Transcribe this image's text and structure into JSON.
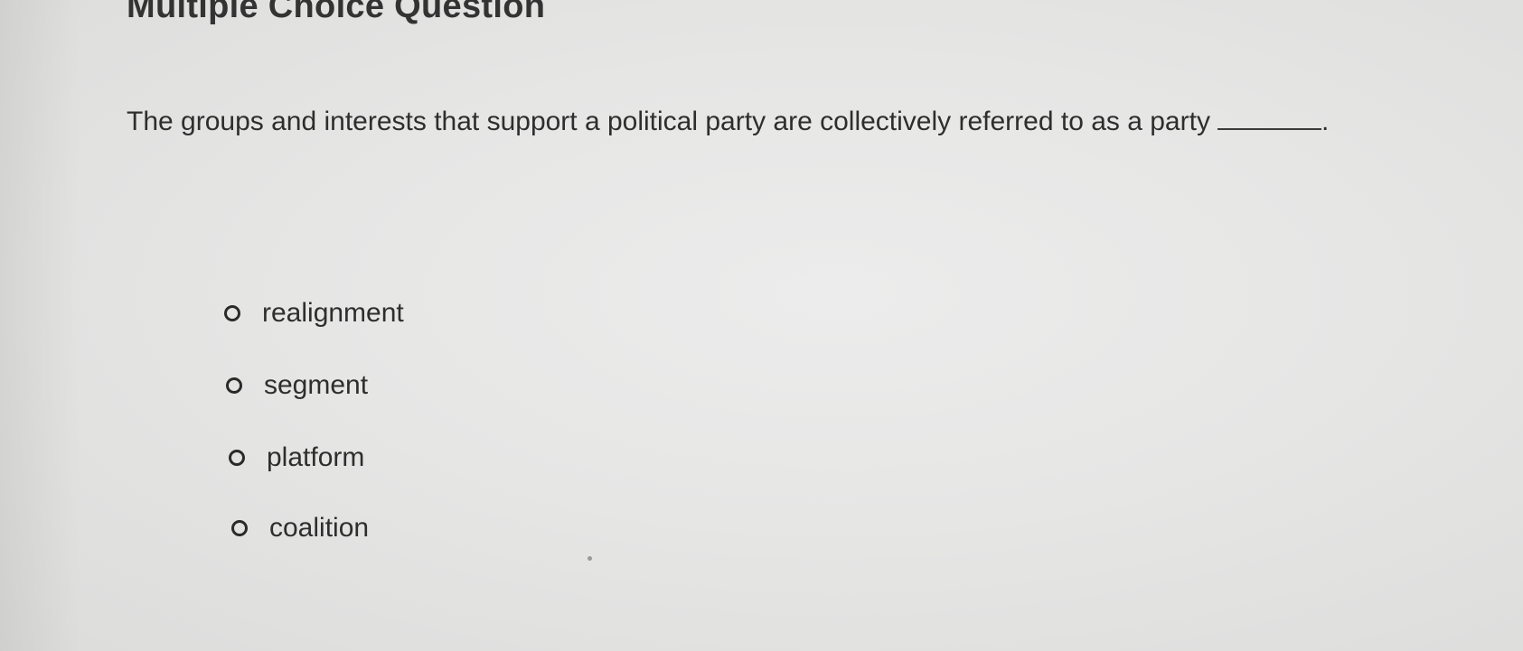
{
  "question_header": {
    "title": "Multiple Choice Question"
  },
  "question": {
    "text": "The groups and interests that support a political party are collectively referred to as a party",
    "end_punct": "."
  },
  "options": [
    {
      "label": "realignment"
    },
    {
      "label": "segment"
    },
    {
      "label": "platform"
    },
    {
      "label": "coalition"
    }
  ],
  "colors": {
    "background": "#e6e6e5",
    "text": "#2e2e2e"
  }
}
